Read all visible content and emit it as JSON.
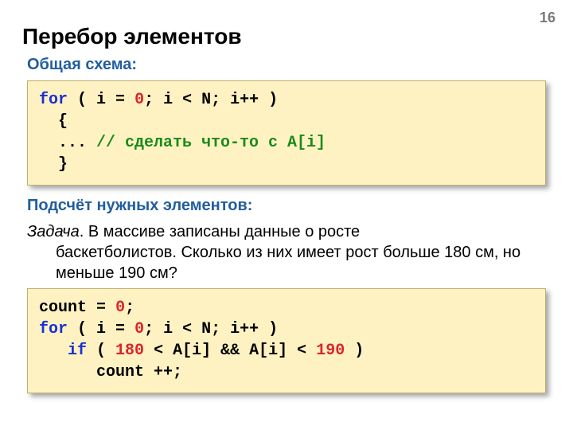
{
  "page_number": "16",
  "title": "Перебор элементов",
  "subhead_scheme": "Общая схема:",
  "code1": {
    "kw_for": "for",
    "t1": " ( i",
    "sp1": " ",
    "eq1": "=",
    "sp2": " ",
    "num_zero1": "0",
    "t2": "; i",
    "sp3": " ",
    "lt1": "<",
    "sp4": " ",
    "t3": "N; i++ )",
    "line2": "  {",
    "line3_a": "  ... ",
    "line3_cmt": "// сделать что-то с A[i]",
    "line4": "  }"
  },
  "subhead_count": "Подсчёт нужных элементов:",
  "task_label": "Задача",
  "task_dot": ". ",
  "task_line1": "В массиве записаны данные о росте",
  "task_rest": "баскетболистов. Сколько из них имеет рост больше 180 см, но меньше 190 см?",
  "code2": {
    "l1_a": "count",
    "l1_sp1": " ",
    "l1_eq": "=",
    "l1_sp2": " ",
    "l1_zero": "0",
    "l1_semi": ";",
    "l2_for": "for",
    "l2_a": " ( i",
    "l2_sp1": " ",
    "l2_eq": "=",
    "l2_sp2": " ",
    "l2_zero": "0",
    "l2_b": "; i",
    "l2_sp3": " ",
    "l2_lt": "<",
    "l2_sp4": " ",
    "l2_c": "N; i++ )",
    "l3_indent": "   ",
    "l3_if": "if",
    "l3_a": " ( ",
    "l3_180": "180",
    "l3_sp1": " ",
    "l3_lt1": "<",
    "l3_sp2": " ",
    "l3_b": "A[i] && A[i]",
    "l3_sp3": " ",
    "l3_lt2": "<",
    "l3_sp4": " ",
    "l3_190": "190",
    "l3_c": " )",
    "l4": "      count ++;"
  }
}
